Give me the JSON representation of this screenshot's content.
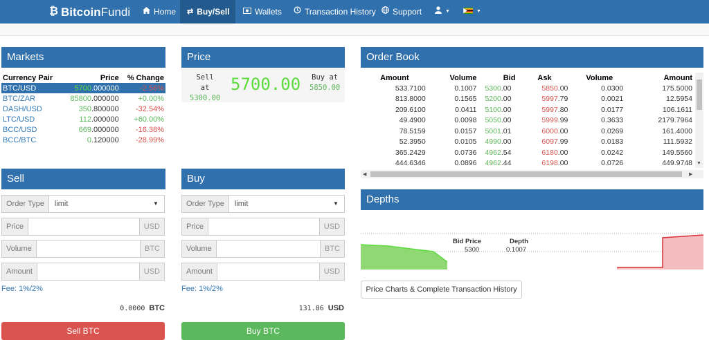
{
  "nav": {
    "brand_bold": "Bitcoin",
    "brand_light": "Fundi",
    "items": [
      {
        "label": "Home",
        "icon": "home-icon"
      },
      {
        "label": "Buy/Sell",
        "icon": "exchange-icon"
      },
      {
        "label": "Wallets",
        "icon": "money-icon"
      },
      {
        "label": "Transaction History",
        "icon": "history-icon"
      },
      {
        "label": "Support",
        "icon": "globe-icon"
      }
    ]
  },
  "markets": {
    "title": "Markets",
    "headers": [
      "Currency Pair",
      "Price",
      "% Change"
    ],
    "rows": [
      {
        "pair": "BTC/USD",
        "price_hi": "5700",
        "price_lo": ".000000",
        "change": "-2.56%",
        "change_type": "neg",
        "selected": true
      },
      {
        "pair": "BTC/ZAR",
        "price_hi": "85800",
        "price_lo": ".000000",
        "change": "+0.00%",
        "change_type": "pos"
      },
      {
        "pair": "DASH/USD",
        "price_hi": "350",
        "price_lo": ".800000",
        "change": "-32.54%",
        "change_type": "neg"
      },
      {
        "pair": "LTC/USD",
        "price_hi": "112",
        "price_lo": ".000000",
        "change": "+60.00%",
        "change_type": "pos"
      },
      {
        "pair": "BCC/USD",
        "price_hi": "669",
        "price_lo": ".000000",
        "change": "-16.38%",
        "change_type": "neg"
      },
      {
        "pair": "BCC/BTC",
        "price_hi": "0",
        "price_lo": ".120000",
        "change": "-28.99%",
        "change_type": "neg"
      }
    ]
  },
  "price": {
    "title": "Price",
    "sell_l1": "Sell",
    "sell_l2": "at",
    "sell_value": "5300.00",
    "current": "5700.00",
    "buy_l1": "Buy at",
    "buy_value": "5850.00"
  },
  "orderbook": {
    "title": "Order Book",
    "headers": [
      "Amount",
      "Volume",
      "Bid",
      "Ask",
      "Volume",
      "Amount"
    ],
    "rows": [
      {
        "amt1": "533.7100",
        "vol1": "0.1007",
        "bid_hi": "5300",
        "bid_lo": ".00",
        "ask_hi": "5850",
        "ask_lo": ".00",
        "vol2": "0.0300",
        "amt2": "175.5000"
      },
      {
        "amt1": "813.8000",
        "vol1": "0.1565",
        "bid_hi": "5200",
        "bid_lo": ".00",
        "ask_hi": "5997",
        "ask_lo": ".79",
        "vol2": "0.0021",
        "amt2": "12.5954"
      },
      {
        "amt1": "209.6100",
        "vol1": "0.0411",
        "bid_hi": "5100",
        "bid_lo": ".00",
        "ask_hi": "5997",
        "ask_lo": ".80",
        "vol2": "0.0177",
        "amt2": "106.1611"
      },
      {
        "amt1": "49.4900",
        "vol1": "0.0098",
        "bid_hi": "5050",
        "bid_lo": ".00",
        "ask_hi": "5999",
        "ask_lo": ".99",
        "vol2": "0.3633",
        "amt2": "2179.7964"
      },
      {
        "amt1": "78.5159",
        "vol1": "0.0157",
        "bid_hi": "5001",
        "bid_lo": ".01",
        "ask_hi": "6000",
        "ask_lo": ".00",
        "vol2": "0.0269",
        "amt2": "161.4000"
      },
      {
        "amt1": "52.3950",
        "vol1": "0.0105",
        "bid_hi": "4990",
        "bid_lo": ".00",
        "ask_hi": "6097",
        "ask_lo": ".99",
        "vol2": "0.0183",
        "amt2": "111.5932"
      },
      {
        "amt1": "365.2429",
        "vol1": "0.0736",
        "bid_hi": "4962",
        "bid_lo": ".54",
        "ask_hi": "6180",
        "ask_lo": ".00",
        "vol2": "0.0242",
        "amt2": "149.5560"
      },
      {
        "amt1": "444.6346",
        "vol1": "0.0896",
        "bid_hi": "4962",
        "bid_lo": ".44",
        "ask_hi": "6198",
        "ask_lo": ".00",
        "vol2": "0.0726",
        "amt2": "449.9748"
      }
    ]
  },
  "sell": {
    "title": "Sell",
    "order_type_label": "Order Type",
    "order_type_value": "limit",
    "price_label": "Price",
    "price_unit": "USD",
    "volume_label": "Volume",
    "volume_unit": "BTC",
    "amount_label": "Amount",
    "amount_unit": "USD",
    "fee": "Fee: 1%/2%",
    "balance_value": "0.0000",
    "balance_unit": "BTC",
    "button": "Sell BTC"
  },
  "buy": {
    "title": "Buy",
    "order_type_label": "Order Type",
    "order_type_value": "limit",
    "price_label": "Price",
    "price_unit": "USD",
    "volume_label": "Volume",
    "volume_unit": "BTC",
    "amount_label": "Amount",
    "amount_unit": "USD",
    "fee": "Fee: 1%/2%",
    "balance_value": "131.86",
    "balance_unit": "USD",
    "button": "Buy BTC"
  },
  "depths": {
    "title": "Depths",
    "tooltip_price_label": "Bid Price",
    "tooltip_depth_label": "Depth",
    "tooltip_price": "5300",
    "tooltip_depth": "0.1007"
  },
  "charts_button": "Price Charts & Complete Transaction History",
  "colors": {
    "primary": "#2f70ad",
    "positive": "#5cb85c",
    "negative": "#d9534f"
  }
}
